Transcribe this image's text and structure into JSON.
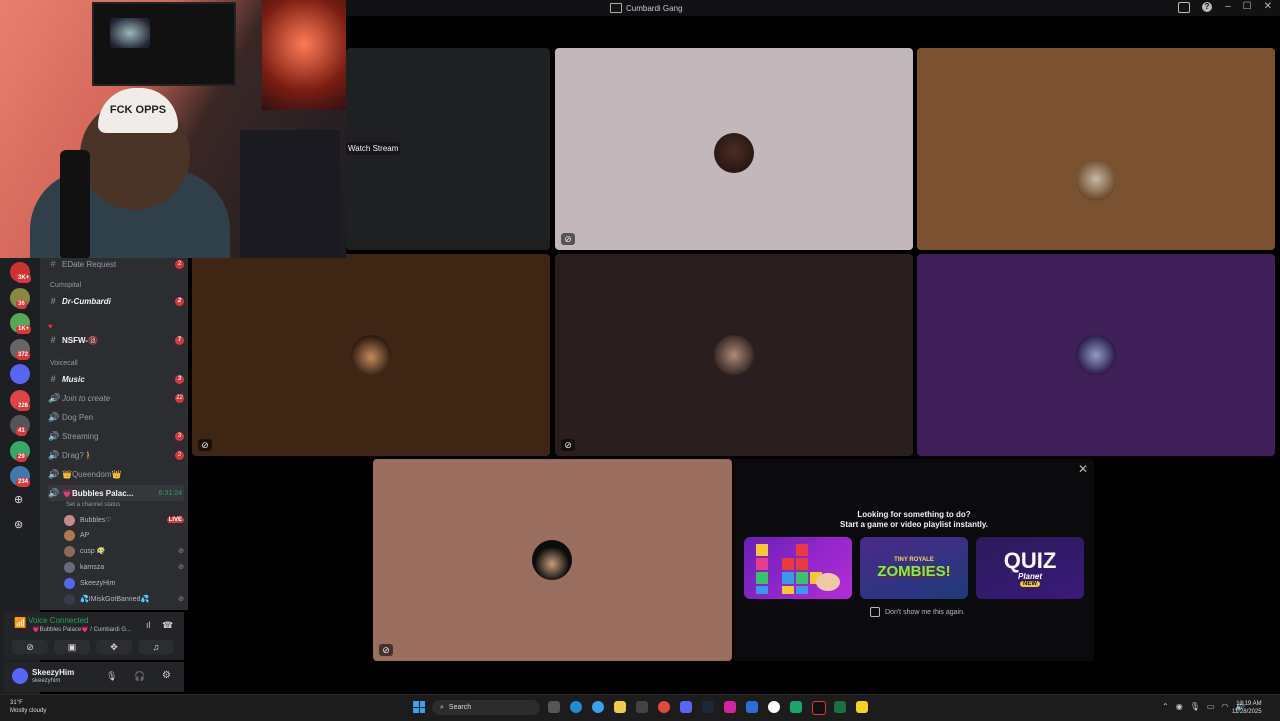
{
  "window": {
    "title": "Cumbardi Gang",
    "controls": [
      "–",
      "☐",
      "✕"
    ]
  },
  "stream": {
    "watch_label": "Watch Stream"
  },
  "webcam": {
    "cap_text": "FCK OPPS"
  },
  "colors": {
    "tile_grey": "#c2b8bb",
    "tile_tan": "#7a5232",
    "tile_brown": "#3f2614",
    "tile_dark": "#2a1e1e",
    "tile_purple": "#3f1f57",
    "tile_rose": "#9a6e5f",
    "accent_green": "#23a55a",
    "live_red": "#da373c"
  },
  "servers": [
    {
      "badge": "3K+"
    },
    {
      "badge": "36"
    },
    {
      "badge": "1K+"
    },
    {
      "badge": "372"
    },
    {
      "badge": ""
    },
    {
      "badge": "226"
    },
    {
      "badge": "41"
    },
    {
      "badge": "29"
    },
    {
      "badge": "234"
    }
  ],
  "channels": {
    "items": [
      {
        "name": "EDate Request",
        "count": "2"
      },
      {
        "category": "Cumspital"
      },
      {
        "name": "Dr-Cumbardi",
        "count": "2"
      },
      {
        "name": "NSFW-🔞",
        "count": "7"
      },
      {
        "category": "Voicecall"
      },
      {
        "name": "Music",
        "count": "3"
      },
      {
        "name": "Join to create",
        "count": "12"
      },
      {
        "name": "Dog Pen",
        "count": ""
      },
      {
        "name": "Streaming",
        "count": "3"
      },
      {
        "name": "Drag?🚶",
        "count": "2"
      },
      {
        "name": "👑Queendom👑",
        "count": ""
      }
    ],
    "active_voice": {
      "name": "💗Bubbles Palac...",
      "timer": "6:31:24",
      "status": "Set a channel status"
    },
    "voice_users": [
      {
        "name": "Bubbles♡",
        "live": "LIVE"
      },
      {
        "name": "AP",
        "live": ""
      },
      {
        "name": "cusp 😶‍🌫️",
        "live": ""
      },
      {
        "name": "kamsza",
        "live": ""
      },
      {
        "name": "SkeezyHim",
        "live": ""
      },
      {
        "name": "💦IMiskGotBanned💦",
        "live": ""
      }
    ]
  },
  "voice_panel": {
    "status": "Voice Connected",
    "location": "💗Bubbles Palace💗 / Cumbardi G..."
  },
  "user": {
    "name": "SkeezyHim",
    "tag": "skeezyhim"
  },
  "activities": {
    "heading_line1": "Looking for something to do?",
    "heading_line2": "Start a game or video playlist instantly.",
    "games": [
      {
        "name": "blocks",
        "label": ""
      },
      {
        "name": "zombies",
        "label": "ZOMBIES!",
        "sub": "TINY ROYALE"
      },
      {
        "name": "quiz",
        "label": "QUIZ",
        "sub": "Planet",
        "badge": "NEW"
      }
    ],
    "dont_show": "Don't show me this again."
  },
  "taskbar": {
    "weather_temp": "31°F",
    "weather_desc": "Mostly cloudy",
    "search_label": "Search",
    "time": "12:19 AM",
    "date": "11/28/2025"
  },
  "icons": [
    "windows-icon",
    "search-icon",
    "edge-icon",
    "folder-icon",
    "discord-icon",
    "steam-icon",
    "instagram-icon",
    "chatgpt-icon",
    "tiktok-icon",
    "sticky-notes-icon"
  ]
}
